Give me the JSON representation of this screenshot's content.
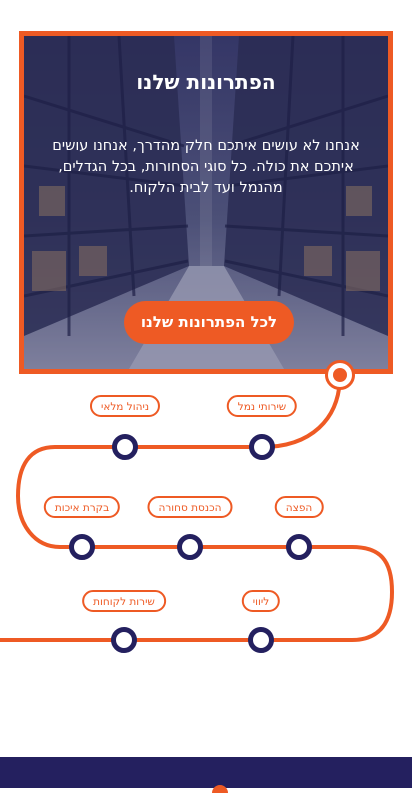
{
  "hero": {
    "title": "הפתרונות שלנו",
    "body": "אנחנו לא עושים איתכם חלק מהדרך, אנחנו עושים איתכם את כולה. כל סוגי הסחורות, בכל הגדלים, מהנמל ועד לבית הלקוח.",
    "button_label": "לכל הפתרונות שלנו"
  },
  "route": {
    "labels": [
      "שירותי נמל",
      "ניהול מלאי",
      "הפצה",
      "הכנסת סחורה",
      "בקרת איכות",
      "ליווי",
      "שירות לקוחות"
    ]
  },
  "colors": {
    "accent": "#ee5a24",
    "navy": "#24205f"
  }
}
